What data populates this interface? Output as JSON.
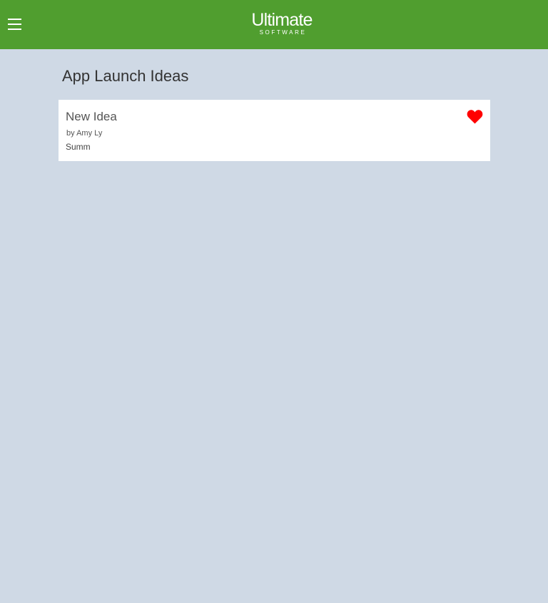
{
  "header": {
    "menu_icon": "hamburger-menu-icon",
    "logo": {
      "main": "Ultimate",
      "sub": "SOFTWARE"
    },
    "background_color": "#509e2f"
  },
  "page": {
    "title": "App Launch Ideas",
    "background_color": "#cfd9e5"
  },
  "ideas": [
    {
      "title": "New Idea",
      "author": "by Amy Ly",
      "summary": "Summ",
      "favorite_icon": "heart-icon",
      "favorited": true,
      "heart_color": "#ff0000"
    }
  ]
}
